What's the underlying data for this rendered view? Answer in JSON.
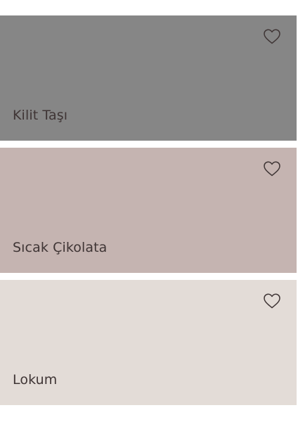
{
  "colors": [
    {
      "name": "Kilit Taşı",
      "swatch": "#868686",
      "icon": "heart-outline-icon"
    },
    {
      "name": "Sıcak Çikolata",
      "swatch": "#c5b4b1",
      "icon": "heart-outline-icon"
    },
    {
      "name": "Lokum",
      "swatch": "#e3dcd7",
      "icon": "heart-outline-icon"
    }
  ],
  "text_color": "#3f3535"
}
